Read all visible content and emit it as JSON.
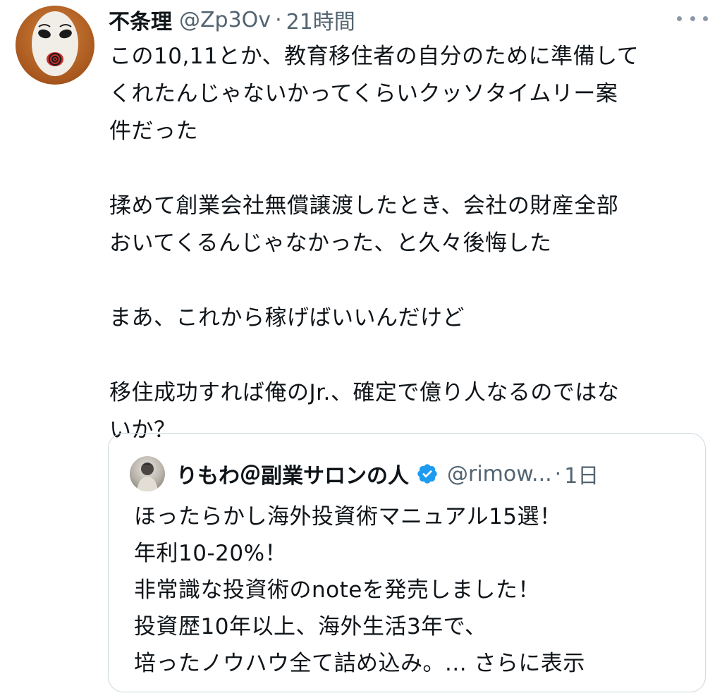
{
  "tweet": {
    "display_name": "不条理",
    "handle": "@Zp3Ov",
    "separator": "·",
    "time": "21時間",
    "text": "この10,11とか、教育移住者の自分のために準備して\nくれたんじゃないかってくらいクッソタイムリー案\n件だった\n\n揉めて創業会社無償譲渡したとき、会社の財産全部\nおいてくるんじゃなかった、と久々後悔した\n\nまあ、これから稼げばいいんだけど\n\n移住成功すれば俺のJr.、確定で億り人なるのではな\nいか？"
  },
  "quoted": {
    "display_name": "りもわ＠副業サロンの人",
    "handle": "@rimow...",
    "separator": "·",
    "time": "1日",
    "text": "ほったらかし海外投資術マニュアル15選！\n年利10-20%！\n非常識な投資術のnoteを発売しました！\n投資歴10年以上、海外生活3年で、\n培ったノウハウ全て詰め込み。... さらに表示"
  },
  "icons": {
    "more": "more-dots-icon",
    "verified": "verified-badge-icon",
    "verified_color": "#1d9bf0"
  }
}
